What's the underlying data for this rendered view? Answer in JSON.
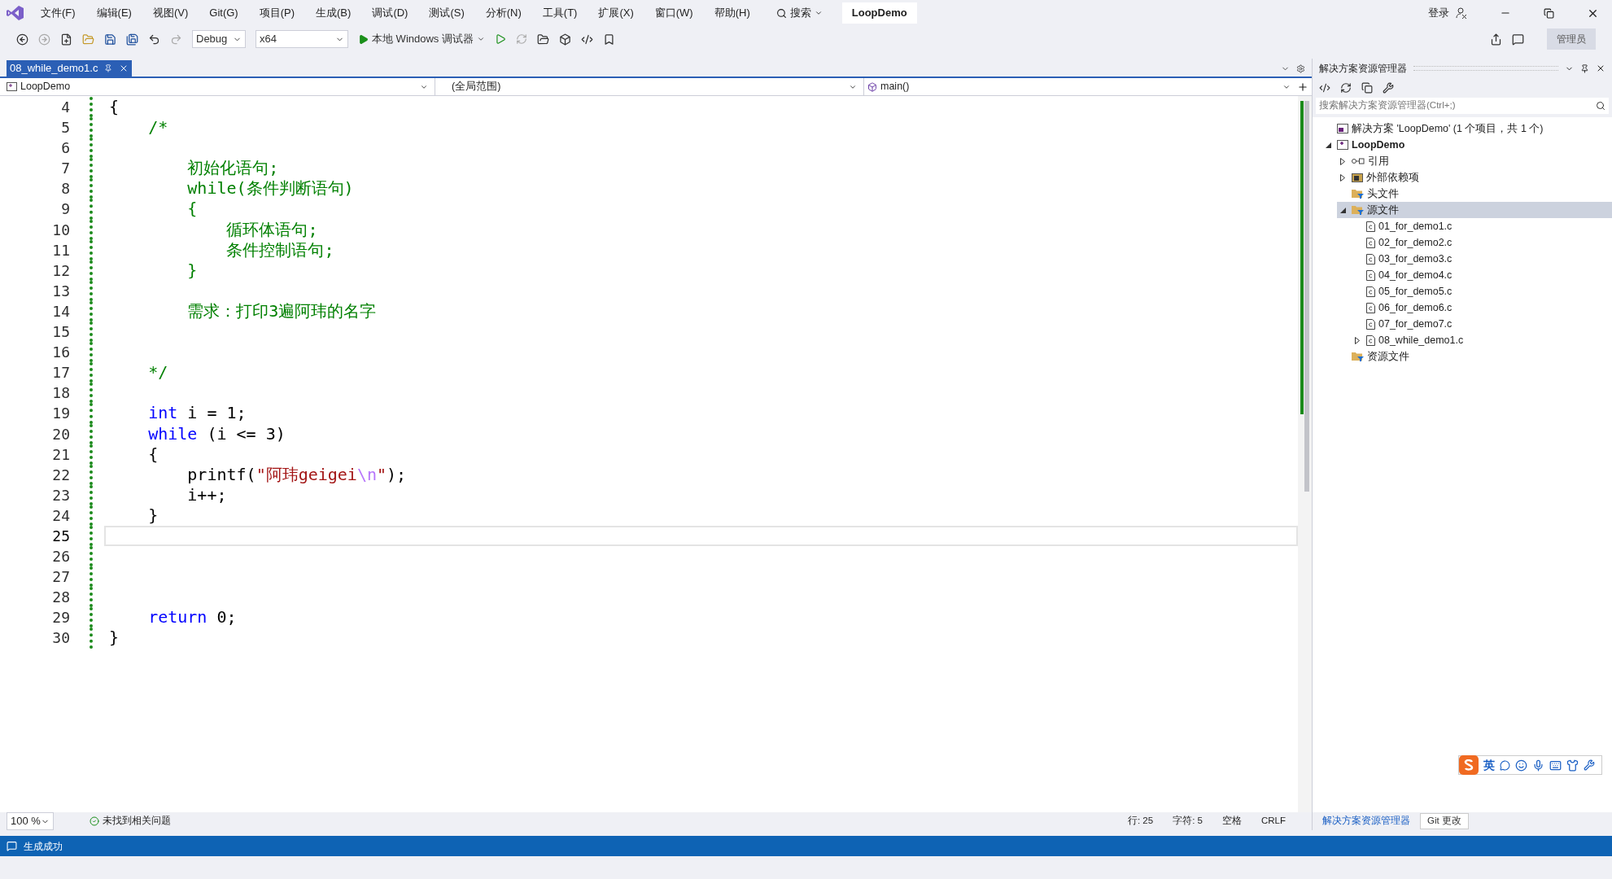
{
  "menu_bar": {
    "items": [
      "文件(F)",
      "编辑(E)",
      "视图(V)",
      "Git(G)",
      "项目(P)",
      "生成(B)",
      "调试(D)",
      "测试(S)",
      "分析(N)",
      "工具(T)",
      "扩展(X)",
      "窗口(W)",
      "帮助(H)"
    ],
    "search": "搜索",
    "solution_name": "LoopDemo",
    "sign_in": "登录",
    "admin": "管理员"
  },
  "toolbar": {
    "configuration": "Debug",
    "platform": "x64",
    "debugger": "本地 Windows 调试器"
  },
  "editor_tabs": [
    {
      "label": "08_while_demo1.c",
      "selected": true
    }
  ],
  "nav_bar": {
    "project": "LoopDemo",
    "scope": "(全局范围)",
    "member": "main()"
  },
  "code": {
    "lines": [
      {
        "number": "4",
        "current": false,
        "tokens": [
          {
            "kind": "plain",
            "text": "{"
          }
        ]
      },
      {
        "number": "5",
        "current": false,
        "tokens": [
          {
            "kind": "comment",
            "text": "    /*"
          }
        ]
      },
      {
        "number": "6",
        "current": false
      },
      {
        "number": "7",
        "current": false,
        "tokens": [
          {
            "kind": "comment",
            "text": "        初始化语句;"
          }
        ]
      },
      {
        "number": "8",
        "current": false,
        "tokens": [
          {
            "kind": "comment",
            "text": "        while(条件判断语句)"
          }
        ]
      },
      {
        "number": "9",
        "current": false,
        "tokens": [
          {
            "kind": "comment",
            "text": "        {"
          }
        ]
      },
      {
        "number": "10",
        "current": false,
        "tokens": [
          {
            "kind": "comment",
            "text": "            循环体语句;"
          }
        ]
      },
      {
        "number": "11",
        "current": false,
        "tokens": [
          {
            "kind": "comment",
            "text": "            条件控制语句;"
          }
        ]
      },
      {
        "number": "12",
        "current": false,
        "tokens": [
          {
            "kind": "comment",
            "text": "        }"
          }
        ]
      },
      {
        "number": "13",
        "current": false
      },
      {
        "number": "14",
        "current": false,
        "tokens": [
          {
            "kind": "comment",
            "text": "        需求：打印3遍阿玮的名字"
          }
        ]
      },
      {
        "number": "15",
        "current": false
      },
      {
        "number": "16",
        "current": false
      },
      {
        "number": "17",
        "current": false,
        "tokens": [
          {
            "kind": "comment",
            "text": "    */"
          }
        ]
      },
      {
        "number": "18",
        "current": false
      },
      {
        "number": "19",
        "current": false,
        "tokens": [
          {
            "kind": "keyword",
            "text": "    int"
          },
          {
            "kind": "plain",
            "text": " i = 1;"
          }
        ]
      },
      {
        "number": "20",
        "current": false,
        "tokens": [
          {
            "kind": "keyword",
            "text": "    while"
          },
          {
            "kind": "plain",
            "text": " (i <= 3)"
          }
        ]
      },
      {
        "number": "21",
        "current": false,
        "tokens": [
          {
            "kind": "plain",
            "text": "    {"
          }
        ]
      },
      {
        "number": "22",
        "current": false,
        "tokens": [
          {
            "kind": "plain",
            "text": "        printf("
          },
          {
            "kind": "string",
            "text": "\"阿玮geigei"
          },
          {
            "kind": "escape",
            "text": "\\n"
          },
          {
            "kind": "string",
            "text": "\""
          },
          {
            "kind": "plain",
            "text": ");"
          }
        ]
      },
      {
        "number": "23",
        "current": false,
        "tokens": [
          {
            "kind": "plain",
            "text": "        i++;"
          }
        ]
      },
      {
        "number": "24",
        "current": false,
        "tokens": [
          {
            "kind": "plain",
            "text": "    }"
          }
        ]
      },
      {
        "number": "25",
        "current": true
      },
      {
        "number": "26",
        "current": false
      },
      {
        "number": "27",
        "current": false
      },
      {
        "number": "28",
        "current": false
      },
      {
        "number": "29",
        "current": false,
        "tokens": [
          {
            "kind": "keyword",
            "text": "    return"
          },
          {
            "kind": "plain",
            "text": " 0;"
          }
        ]
      },
      {
        "number": "30",
        "current": false,
        "tokens": [
          {
            "kind": "plain",
            "text": "}"
          }
        ]
      }
    ]
  },
  "editor_status": {
    "zoom": "100 %",
    "issues": "未找到相关问题",
    "line": "行: 25",
    "char": "字符: 5",
    "whitespace": "空格",
    "line_ending": "CRLF"
  },
  "solution_explorer": {
    "title": "解决方案资源管理器",
    "search_placeholder": "搜索解决方案资源管理器(Ctrl+;)",
    "tree": [
      {
        "kind": "solution",
        "label": "解决方案 'LoopDemo' (1 个项目，共 1 个)",
        "selected": false,
        "children": [
          {
            "kind": "project",
            "label": "LoopDemo",
            "expanded": true,
            "selected": false,
            "children": [
              {
                "kind": "references",
                "label": "引用",
                "expanded": false,
                "selected": false
              },
              {
                "kind": "dependencies",
                "label": "外部依赖项",
                "expanded": false,
                "selected": false
              },
              {
                "kind": "filter",
                "label": "头文件",
                "selected": false
              },
              {
                "kind": "filter",
                "label": "源文件",
                "expanded": true,
                "selected": true,
                "children": [
                  {
                    "kind": "file",
                    "label": "01_for_demo1.c",
                    "selected": false
                  },
                  {
                    "kind": "file",
                    "label": "02_for_demo2.c",
                    "selected": false
                  },
                  {
                    "kind": "file",
                    "label": "03_for_demo3.c",
                    "selected": false
                  },
                  {
                    "kind": "file",
                    "label": "04_for_demo4.c",
                    "selected": false
                  },
                  {
                    "kind": "file",
                    "label": "05_for_demo5.c",
                    "selected": false
                  },
                  {
                    "kind": "file",
                    "label": "06_for_demo6.c",
                    "selected": false
                  },
                  {
                    "kind": "file",
                    "label": "07_for_demo7.c",
                    "selected": false
                  },
                  {
                    "kind": "file",
                    "label": "08_while_demo1.c",
                    "expanded": false,
                    "selected": false
                  }
                ]
              },
              {
                "kind": "filter",
                "label": "资源文件",
                "selected": false
              }
            ]
          }
        ]
      }
    ],
    "tabs": [
      {
        "label": "解决方案资源管理器",
        "selected": true
      },
      {
        "label": "Git 更改",
        "selected": false
      }
    ]
  },
  "ime_toolbar": {
    "mode": "英"
  },
  "status_bar": {
    "message": "生成成功"
  }
}
